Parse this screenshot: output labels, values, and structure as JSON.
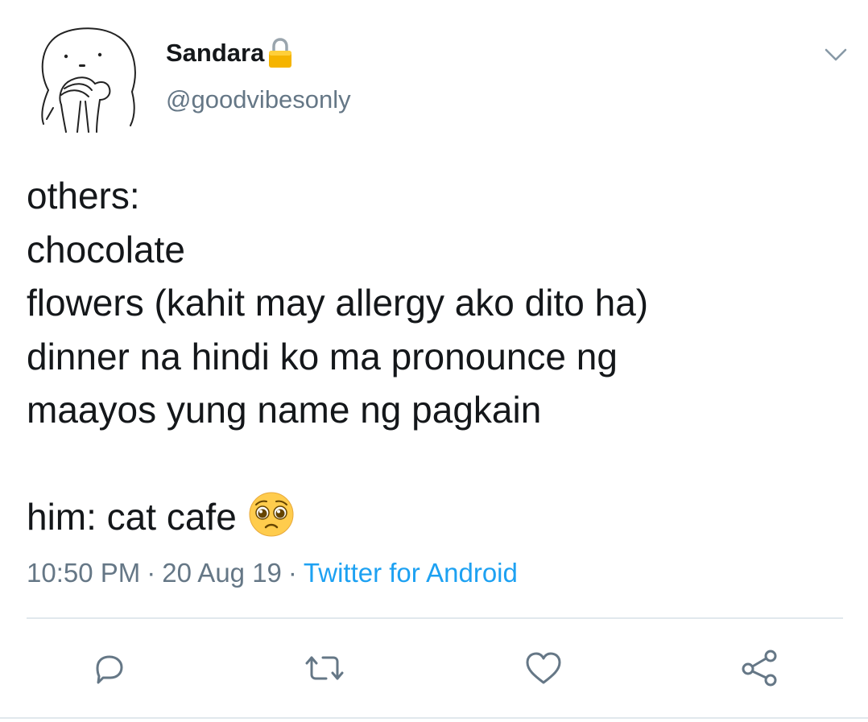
{
  "tweet": {
    "display_name": "Sandara",
    "handle": "@goodvibesonly",
    "protected_icon": "lock-icon",
    "menu_icon": "chevron-down-icon",
    "lines": [
      "others:",
      "chocolate",
      "flowers (kahit may allergy ako dito ha)",
      "dinner na hindi ko ma pronounce ng",
      "maayos yung name ng pagkain",
      "",
      "him: cat cafe"
    ],
    "emoji": "pleading-face-emoji",
    "time": "10:50 PM",
    "date": "20 Aug 19",
    "separator": "·",
    "source": "Twitter for Android"
  },
  "actions": {
    "reply_icon": "reply-icon",
    "retweet_icon": "retweet-icon",
    "like_icon": "heart-icon",
    "share_icon": "share-icon"
  },
  "colors": {
    "text": "#14171a",
    "secondary": "#657786",
    "link": "#1da1f2",
    "divider": "#e1e8ed",
    "lock": "#f5b400"
  }
}
